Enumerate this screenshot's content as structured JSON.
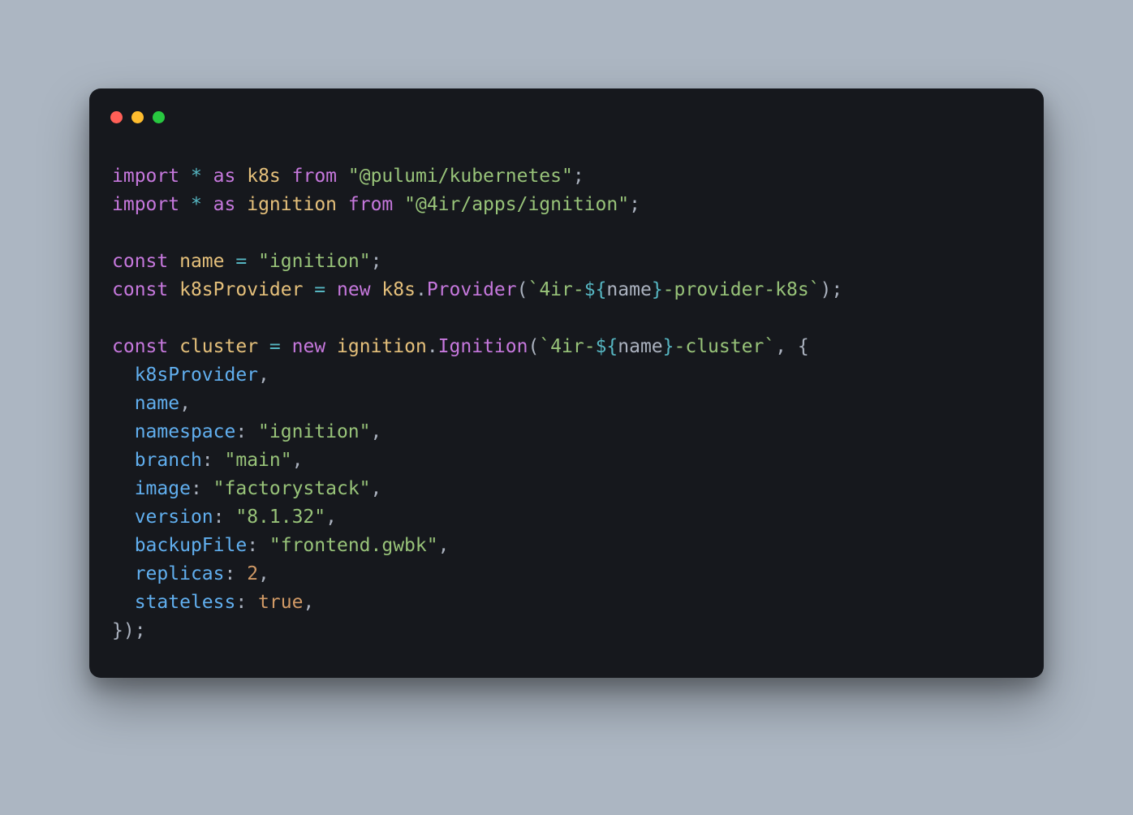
{
  "code": {
    "tokens": [
      [
        [
          "kw",
          "import"
        ],
        [
          "punc",
          " "
        ],
        [
          "op",
          "*"
        ],
        [
          "punc",
          " "
        ],
        [
          "kw",
          "as"
        ],
        [
          "punc",
          " "
        ],
        [
          "ident",
          "k8s"
        ],
        [
          "punc",
          " "
        ],
        [
          "kw",
          "from"
        ],
        [
          "punc",
          " "
        ],
        [
          "str",
          "\"@pulumi/kubernetes\""
        ],
        [
          "punc",
          ";"
        ]
      ],
      [
        [
          "kw",
          "import"
        ],
        [
          "punc",
          " "
        ],
        [
          "op",
          "*"
        ],
        [
          "punc",
          " "
        ],
        [
          "kw",
          "as"
        ],
        [
          "punc",
          " "
        ],
        [
          "ident",
          "ignition"
        ],
        [
          "punc",
          " "
        ],
        [
          "kw",
          "from"
        ],
        [
          "punc",
          " "
        ],
        [
          "str",
          "\"@4ir/apps/ignition\""
        ],
        [
          "punc",
          ";"
        ]
      ],
      [],
      [
        [
          "kw",
          "const"
        ],
        [
          "punc",
          " "
        ],
        [
          "ident",
          "name"
        ],
        [
          "punc",
          " "
        ],
        [
          "op",
          "="
        ],
        [
          "punc",
          " "
        ],
        [
          "str",
          "\"ignition\""
        ],
        [
          "punc",
          ";"
        ]
      ],
      [
        [
          "kw",
          "const"
        ],
        [
          "punc",
          " "
        ],
        [
          "ident",
          "k8sProvider"
        ],
        [
          "punc",
          " "
        ],
        [
          "op",
          "="
        ],
        [
          "punc",
          " "
        ],
        [
          "kw",
          "new"
        ],
        [
          "punc",
          " "
        ],
        [
          "ident",
          "k8s"
        ],
        [
          "punc",
          "."
        ],
        [
          "call",
          "Provider"
        ],
        [
          "punc",
          "("
        ],
        [
          "tmpl",
          "`4ir-"
        ],
        [
          "tmplbr",
          "${"
        ],
        [
          "plain",
          "name"
        ],
        [
          "tmplbr",
          "}"
        ],
        [
          "tmpl",
          "-provider-k8s`"
        ],
        [
          "punc",
          ");"
        ]
      ],
      [],
      [
        [
          "kw",
          "const"
        ],
        [
          "punc",
          " "
        ],
        [
          "ident",
          "cluster"
        ],
        [
          "punc",
          " "
        ],
        [
          "op",
          "="
        ],
        [
          "punc",
          " "
        ],
        [
          "kw",
          "new"
        ],
        [
          "punc",
          " "
        ],
        [
          "ident",
          "ignition"
        ],
        [
          "punc",
          "."
        ],
        [
          "call",
          "Ignition"
        ],
        [
          "punc",
          "("
        ],
        [
          "tmpl",
          "`4ir-"
        ],
        [
          "tmplbr",
          "${"
        ],
        [
          "plain",
          "name"
        ],
        [
          "tmplbr",
          "}"
        ],
        [
          "tmpl",
          "-cluster`"
        ],
        [
          "punc",
          ", {"
        ]
      ],
      [
        [
          "punc",
          "  "
        ],
        [
          "ident2",
          "k8sProvider"
        ],
        [
          "punc",
          ","
        ]
      ],
      [
        [
          "punc",
          "  "
        ],
        [
          "ident2",
          "name"
        ],
        [
          "punc",
          ","
        ]
      ],
      [
        [
          "punc",
          "  "
        ],
        [
          "ident2",
          "namespace"
        ],
        [
          "punc",
          ": "
        ],
        [
          "str",
          "\"ignition\""
        ],
        [
          "punc",
          ","
        ]
      ],
      [
        [
          "punc",
          "  "
        ],
        [
          "ident2",
          "branch"
        ],
        [
          "punc",
          ": "
        ],
        [
          "str",
          "\"main\""
        ],
        [
          "punc",
          ","
        ]
      ],
      [
        [
          "punc",
          "  "
        ],
        [
          "ident2",
          "image"
        ],
        [
          "punc",
          ": "
        ],
        [
          "str",
          "\"factorystack\""
        ],
        [
          "punc",
          ","
        ]
      ],
      [
        [
          "punc",
          "  "
        ],
        [
          "ident2",
          "version"
        ],
        [
          "punc",
          ": "
        ],
        [
          "str",
          "\"8.1.32\""
        ],
        [
          "punc",
          ","
        ]
      ],
      [
        [
          "punc",
          "  "
        ],
        [
          "ident2",
          "backupFile"
        ],
        [
          "punc",
          ": "
        ],
        [
          "str",
          "\"frontend.gwbk\""
        ],
        [
          "punc",
          ","
        ]
      ],
      [
        [
          "punc",
          "  "
        ],
        [
          "ident2",
          "replicas"
        ],
        [
          "punc",
          ": "
        ],
        [
          "num",
          "2"
        ],
        [
          "punc",
          ","
        ]
      ],
      [
        [
          "punc",
          "  "
        ],
        [
          "ident2",
          "stateless"
        ],
        [
          "punc",
          ": "
        ],
        [
          "bool",
          "true"
        ],
        [
          "punc",
          ","
        ]
      ],
      [
        [
          "punc",
          "});"
        ]
      ]
    ]
  },
  "traffic_light_colors": {
    "red": "#ff5f57",
    "yellow": "#febc2e",
    "green": "#28c840"
  }
}
